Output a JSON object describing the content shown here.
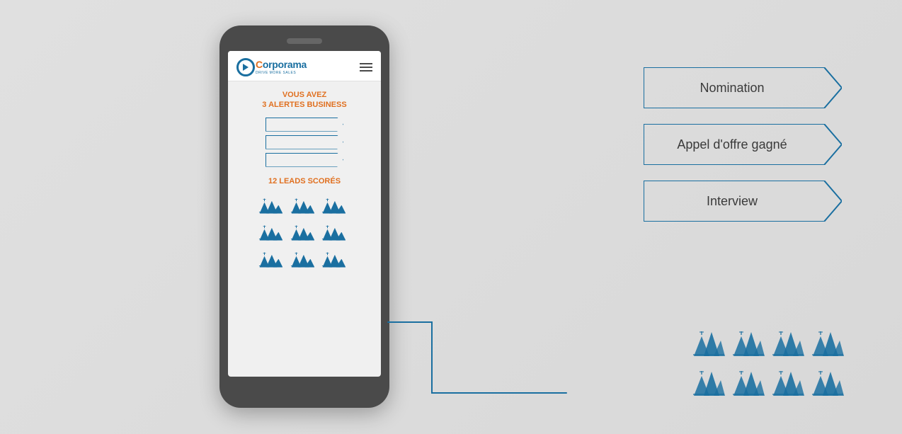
{
  "background_color": "#dcdcdc",
  "phone": {
    "logo_text": "orporama",
    "logo_tagline": "DRIVE MORE SALES",
    "menu_icon": "≡",
    "alert_line1": "VOUS AVEZ",
    "alert_line2": "3 ALERTES BUSINESS",
    "badges": [
      {
        "id": "badge1",
        "label": ""
      },
      {
        "id": "badge2",
        "label": ""
      },
      {
        "id": "badge3",
        "label": ""
      }
    ],
    "leads_title": "12 LEADS SCORÉS",
    "leads_count": 9
  },
  "right_panel": {
    "tags": [
      {
        "id": "tag-nomination",
        "label": "Nomination"
      },
      {
        "id": "tag-appel",
        "label": "Appel d'offre gagné"
      },
      {
        "id": "tag-interview",
        "label": "Interview"
      }
    ],
    "leads_grid_rows": 2,
    "leads_grid_cols": 4
  },
  "brand": {
    "primary_color": "#1a6fa0",
    "accent_color": "#e07020"
  }
}
